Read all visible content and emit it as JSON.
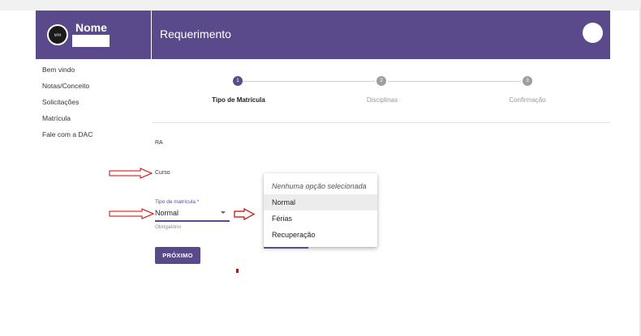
{
  "sidebar": {
    "user_name": "Nome",
    "avatar_text": "NPM",
    "items": [
      {
        "label": "Bem vindo"
      },
      {
        "label": "Notas/Conceito"
      },
      {
        "label": "Solicitações"
      },
      {
        "label": "Matrícula"
      },
      {
        "label": "Fale com a DAC"
      }
    ]
  },
  "appbar": {
    "title": "Requerimento"
  },
  "stepper": {
    "steps": [
      {
        "number": "1",
        "label": "Tipo de Matrícula",
        "active": true
      },
      {
        "number": "2",
        "label": "Disciplinas",
        "active": false
      },
      {
        "number": "3",
        "label": "Confirmação",
        "active": false
      }
    ]
  },
  "form": {
    "ra_label": "RA",
    "curso_label": "Curso",
    "tipo_label": "Tipo de matrícula *",
    "tipo_value": "Normal",
    "tipo_hint": "Obrigatório",
    "next_button": "PRÓXIMO"
  },
  "dropdown": {
    "options": [
      {
        "label": "Nenhuma opção selecionada",
        "placeholder": true
      },
      {
        "label": "Normal",
        "selected": true
      },
      {
        "label": "Férias"
      },
      {
        "label": "Recuperação"
      }
    ]
  },
  "colors": {
    "primary": "#5b4a8b",
    "annotation_arrow": "#d00000"
  }
}
